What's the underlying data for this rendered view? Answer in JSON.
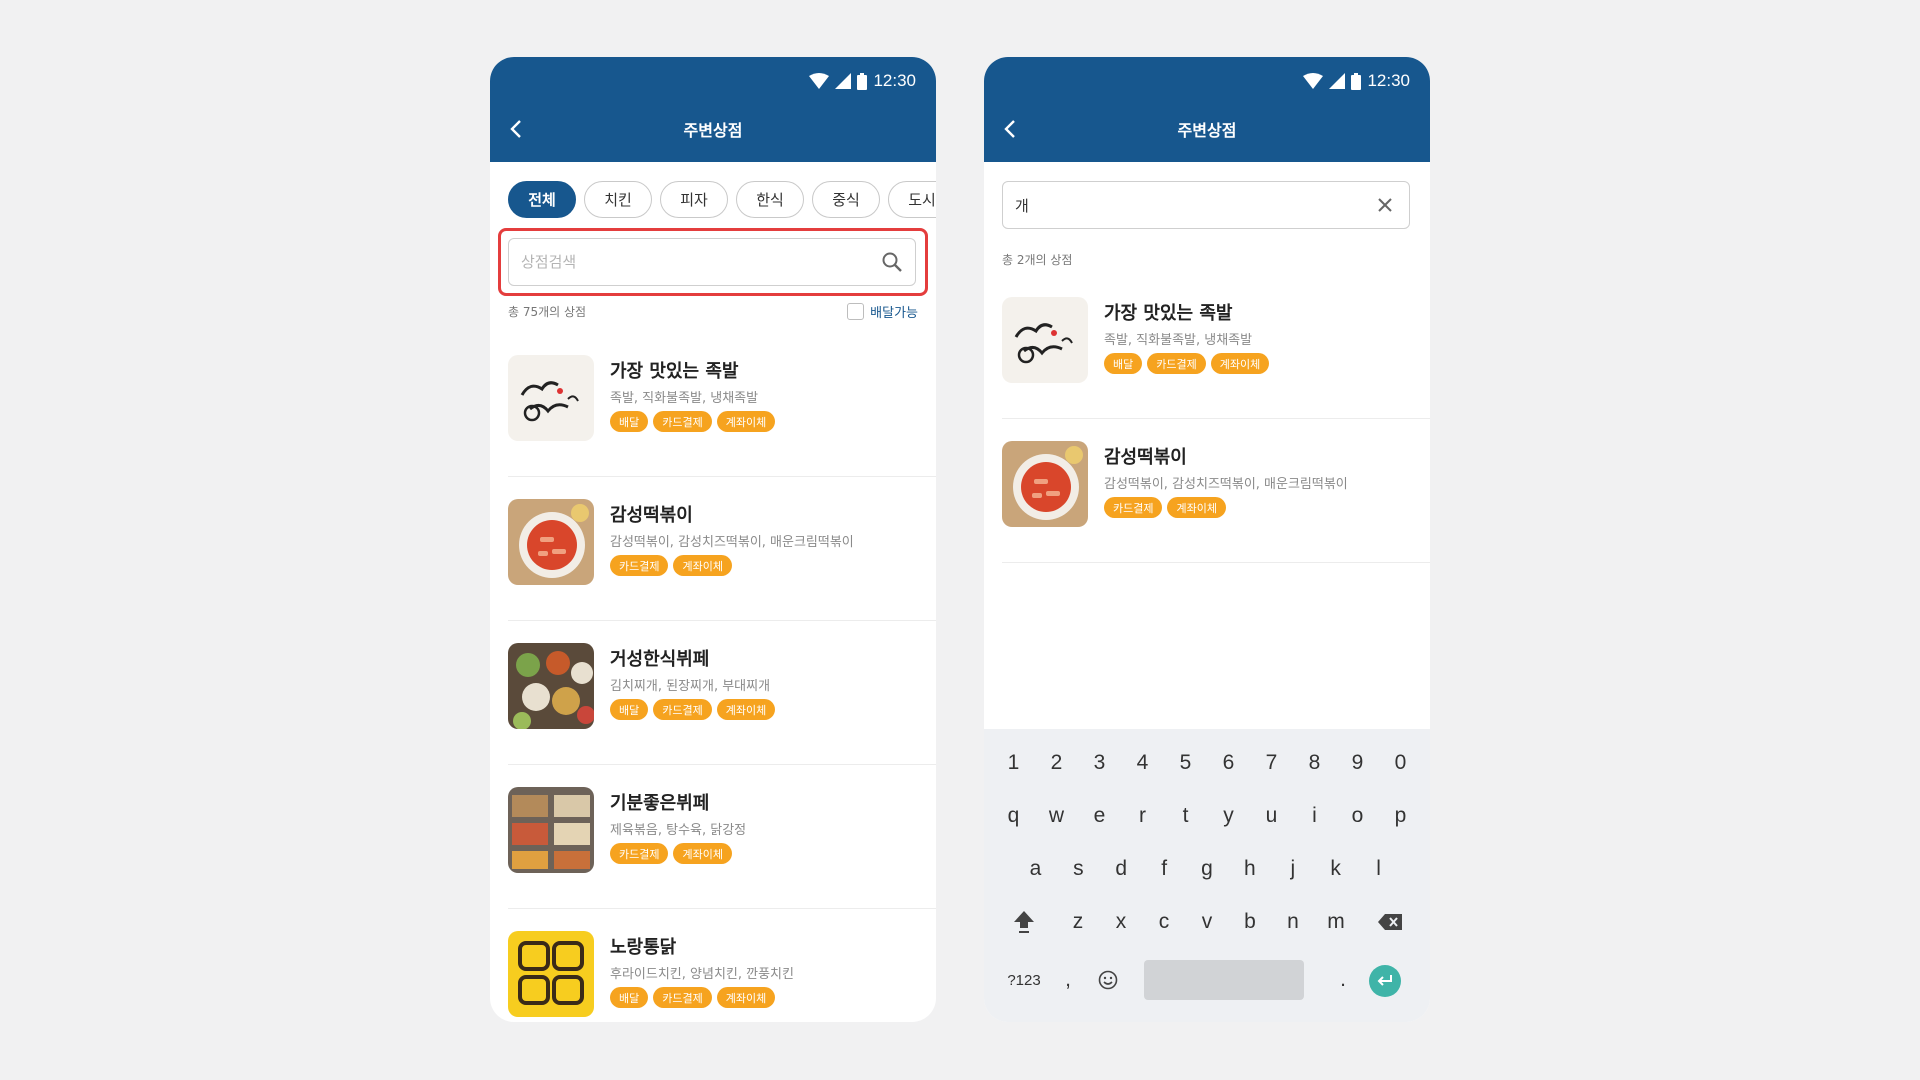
{
  "status": {
    "time": "12:30"
  },
  "left": {
    "title": "주변상점",
    "categories": [
      "전체",
      "치킨",
      "피자",
      "한식",
      "중식",
      "도시"
    ],
    "search_placeholder": "상점검색",
    "count_text": "총 75개의 상점",
    "delivery_filter_label": "배달가능",
    "stores": [
      {
        "name": "가장 맛있는 족발",
        "menu": "족발, 직화불족발, 냉채족발",
        "tags": [
          "배달",
          "카드결제",
          "계좌이체"
        ]
      },
      {
        "name": "감성떡볶이",
        "menu": "감성떡볶이, 감성치즈떡볶이, 매운크림떡볶이",
        "tags": [
          "카드결제",
          "계좌이체"
        ]
      },
      {
        "name": "거성한식뷔페",
        "menu": "김치찌개, 된장찌개, 부대찌개",
        "tags": [
          "배달",
          "카드결제",
          "계좌이체"
        ]
      },
      {
        "name": "기분좋은뷔페",
        "menu": "제육볶음, 탕수육, 닭강정",
        "tags": [
          "카드결제",
          "계좌이체"
        ]
      },
      {
        "name": "노랑통닭",
        "menu": "후라이드치킨, 양념치킨, 깐풍치킨",
        "tags": [
          "배달",
          "카드결제",
          "계좌이체"
        ]
      }
    ]
  },
  "right": {
    "title": "주변상점",
    "search_value": "개",
    "count_text": "총 2개의 상점",
    "stores": [
      {
        "name": "가장 맛있는 족발",
        "menu": "족발, 직화불족발, 냉채족발",
        "tags": [
          "배달",
          "카드결제",
          "계좌이체"
        ]
      },
      {
        "name": "감성떡볶이",
        "menu": "감성떡볶이, 감성치즈떡볶이, 매운크림떡볶이",
        "tags": [
          "카드결제",
          "계좌이체"
        ]
      }
    ],
    "keyboard": {
      "row1": [
        "1",
        "2",
        "3",
        "4",
        "5",
        "6",
        "7",
        "8",
        "9",
        "0"
      ],
      "row2": [
        "q",
        "w",
        "e",
        "r",
        "t",
        "y",
        "u",
        "i",
        "o",
        "p"
      ],
      "row3": [
        "a",
        "s",
        "d",
        "f",
        "g",
        "h",
        "j",
        "k",
        "l"
      ],
      "row4": [
        "z",
        "x",
        "c",
        "v",
        "b",
        "n",
        "m"
      ],
      "symbols_label": "?123",
      "comma": ",",
      "period": "."
    }
  },
  "colors": {
    "primary": "#17578e",
    "tag": "#f6a31f",
    "highlight": "#e43d3d",
    "enter": "#3fb4a8"
  },
  "icons": [
    "wifi-icon",
    "signal-icon",
    "battery-icon",
    "back-arrow-icon",
    "search-icon",
    "clear-icon",
    "shift-icon",
    "backspace-icon",
    "emoji-icon",
    "enter-icon"
  ]
}
